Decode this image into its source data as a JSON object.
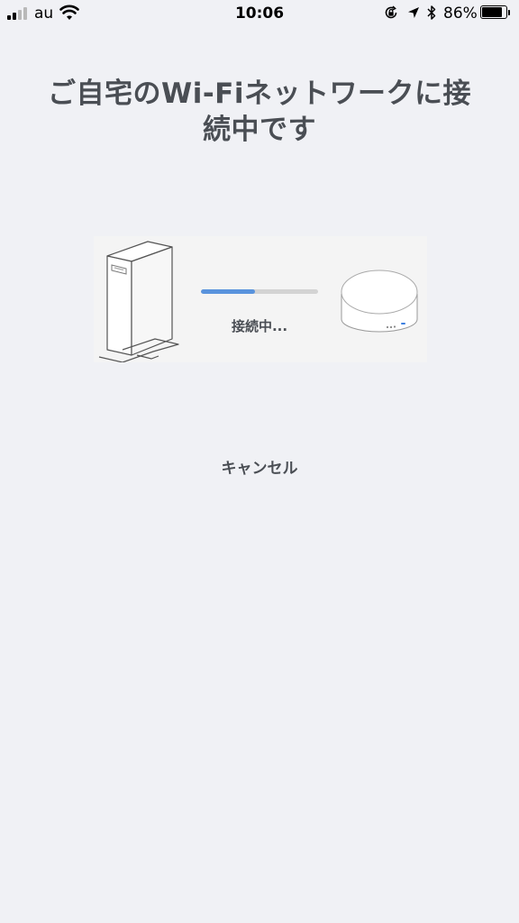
{
  "status_bar": {
    "carrier": "au",
    "time": "10:06",
    "battery_percent": "86%",
    "battery_level": 0.86,
    "signal_bars": 2,
    "icons": [
      "signal-icon",
      "wifi-icon",
      "orientation-lock-icon",
      "location-icon",
      "bluetooth-icon",
      "battery-icon"
    ]
  },
  "page": {
    "title": "ご自宅のWi-Fiネットワークに接続中です",
    "status": "接続中...",
    "progress": 0.46,
    "cancel_label": "キャンセル"
  },
  "colors": {
    "background": "#f0f1f5",
    "text": "#4a4e54",
    "progress_fill": "#5993dd",
    "progress_track": "#d3d3d3"
  }
}
